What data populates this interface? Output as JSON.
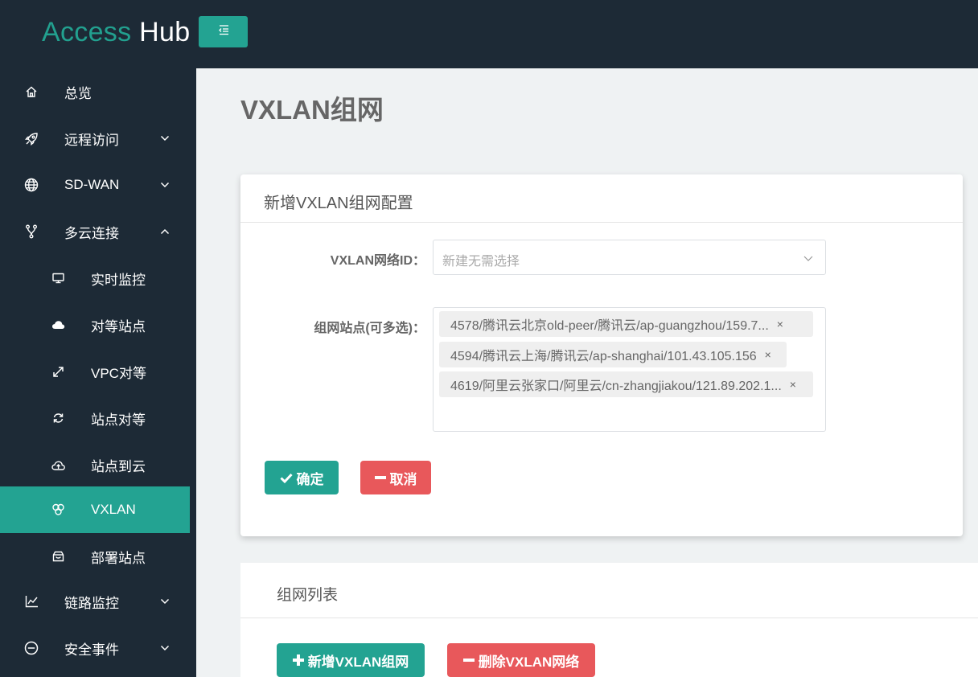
{
  "app": {
    "logo_part1": "Access",
    "logo_part2": "Hub"
  },
  "sidebar": {
    "items": [
      {
        "label": "总览",
        "icon": "home-icon"
      },
      {
        "label": "远程访问",
        "icon": "rocket-icon"
      },
      {
        "label": "SD-WAN",
        "icon": "globe-icon"
      },
      {
        "label": "多云连接",
        "icon": "branch-icon"
      },
      {
        "label": "实时监控",
        "icon": "monitor-icon"
      },
      {
        "label": "对等站点",
        "icon": "cloud-icon"
      },
      {
        "label": "VPC对等",
        "icon": "expand-icon"
      },
      {
        "label": "站点对等",
        "icon": "sync-icon"
      },
      {
        "label": "站点到云",
        "icon": "cloud-upload-icon"
      },
      {
        "label": "VXLAN",
        "icon": "rings-icon"
      },
      {
        "label": "部署站点",
        "icon": "box-icon"
      },
      {
        "label": "链路监控",
        "icon": "chart-line-icon"
      },
      {
        "label": "安全事件",
        "icon": "minus-circle-icon"
      }
    ]
  },
  "main": {
    "page_title": "VXLAN组网",
    "form_card": {
      "title": "新增VXLAN组网配置",
      "vxlan_id_label": "VXLAN网络ID：",
      "vxlan_id_placeholder": "新建无需选择",
      "sites_label": "组网站点(可多选)：",
      "selected_sites": [
        "4578/腾讯云北京old-peer/腾讯云/ap-guangzhou/159.7...",
        "4594/腾讯云上海/腾讯云/ap-shanghai/101.43.105.156",
        "4619/阿里云张家口/阿里云/cn-zhangjiakou/121.89.202.1..."
      ],
      "remove_symbol": "×",
      "confirm_label": "确定",
      "cancel_label": "取消"
    },
    "list": {
      "title": "组网列表",
      "add_label": "新增VXLAN组网",
      "delete_label": "删除VXLAN网络"
    }
  },
  "colors": {
    "sidebar_bg": "#1d2a36",
    "accent": "#23a392",
    "danger": "#e8585b"
  }
}
